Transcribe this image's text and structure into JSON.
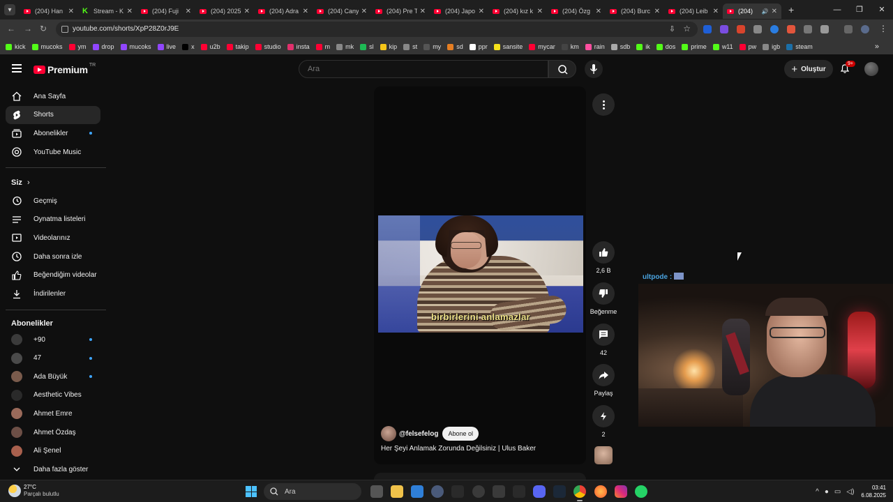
{
  "browser": {
    "tabs": [
      {
        "label": "(204) Han",
        "favicon": "youtube"
      },
      {
        "label": "Stream - K",
        "favicon": "kick"
      },
      {
        "label": "(204) Fuji",
        "favicon": "youtube"
      },
      {
        "label": "(204) 2025",
        "favicon": "youtube"
      },
      {
        "label": "(204) Adra",
        "favicon": "youtube"
      },
      {
        "label": "(204) Cany",
        "favicon": "youtube"
      },
      {
        "label": "(204) Pre T",
        "favicon": "youtube"
      },
      {
        "label": "(204) Japo",
        "favicon": "youtube"
      },
      {
        "label": "(204) kız k",
        "favicon": "youtube"
      },
      {
        "label": "(204) Özg",
        "favicon": "youtube"
      },
      {
        "label": "(204) Burc",
        "favicon": "youtube"
      },
      {
        "label": "(204) Leib",
        "favicon": "youtube"
      },
      {
        "label": "(204)",
        "favicon": "youtube",
        "active": true
      }
    ],
    "new_tab": "+",
    "url": "youtube.com/shorts/XpP28Z0rJ9E",
    "bookmarks": [
      {
        "label": "kick",
        "color": "#53fc18"
      },
      {
        "label": "mucoks",
        "color": "#53fc18"
      },
      {
        "label": "ym",
        "color": "#ff0033"
      },
      {
        "label": "drop",
        "color": "#9146ff"
      },
      {
        "label": "mucoks",
        "color": "#9146ff"
      },
      {
        "label": "live",
        "color": "#9146ff"
      },
      {
        "label": "x",
        "color": "#000000"
      },
      {
        "label": "u2b",
        "color": "#ff0033"
      },
      {
        "label": "takip",
        "color": "#ff0033"
      },
      {
        "label": "studio",
        "color": "#ff0033"
      },
      {
        "label": "insta",
        "color": "#e1306c"
      },
      {
        "label": "m",
        "color": "#ff0033"
      },
      {
        "label": "mk",
        "color": "#888888"
      },
      {
        "label": "sl",
        "color": "#1db954"
      },
      {
        "label": "kip",
        "color": "#f5c518"
      },
      {
        "label": "st",
        "color": "#888888"
      },
      {
        "label": "my",
        "color": "#555555"
      },
      {
        "label": "sd",
        "color": "#e67e22"
      },
      {
        "label": "ppr",
        "color": "#ffffff"
      },
      {
        "label": "sansite",
        "color": "#f5e11b"
      },
      {
        "label": "mycar",
        "color": "#ff0033"
      },
      {
        "label": "km",
        "color": "#444444"
      },
      {
        "label": "rain",
        "color": "#ff4fa0"
      },
      {
        "label": "sdb",
        "color": "#aaaaaa"
      },
      {
        "label": "ik",
        "color": "#53fc18"
      },
      {
        "label": "dos",
        "color": "#53fc18"
      },
      {
        "label": "prime",
        "color": "#53fc18"
      },
      {
        "label": "w11",
        "color": "#53fc18"
      },
      {
        "label": "pw",
        "color": "#ff0033"
      },
      {
        "label": "igb",
        "color": "#888888"
      },
      {
        "label": "steam",
        "color": "#1b6fa8"
      }
    ],
    "bookmarks_overflow": "»"
  },
  "youtube": {
    "logo_text": "Premium",
    "country_code": "TR",
    "search_placeholder": "Ara",
    "create_label": "Oluştur",
    "notif_badge": "9+"
  },
  "sidebar": {
    "main": [
      {
        "label": "Ana Sayfa",
        "icon": "home-icon"
      },
      {
        "label": "Shorts",
        "icon": "shorts-icon",
        "active": true
      },
      {
        "label": "Abonelikler",
        "icon": "subscriptions-icon",
        "dot": true
      },
      {
        "label": "YouTube Music",
        "icon": "music-icon"
      }
    ],
    "you_heading": "Siz",
    "you": [
      {
        "label": "Geçmiş",
        "icon": "history-icon"
      },
      {
        "label": "Oynatma listeleri",
        "icon": "playlist-icon"
      },
      {
        "label": "Videolarınız",
        "icon": "your-videos-icon"
      },
      {
        "label": "Daha sonra izle",
        "icon": "watch-later-icon"
      },
      {
        "label": "Beğendiğim videolar",
        "icon": "liked-icon"
      },
      {
        "label": "İndirilenler",
        "icon": "download-icon"
      }
    ],
    "subs_heading": "Abonelikler",
    "subs": [
      {
        "label": "+90",
        "color": "#3b3b3b",
        "dot": true
      },
      {
        "label": "47",
        "color": "#4a4a4a",
        "dot": true
      },
      {
        "label": "Ada Büyük",
        "color": "#7a5b4c",
        "dot": true
      },
      {
        "label": "Aesthetic Vibes",
        "color": "#2a2a2a"
      },
      {
        "label": "Ahmet Emre",
        "color": "#9a6a5a"
      },
      {
        "label": "Ahmet Özdaş",
        "color": "#6d4f46"
      },
      {
        "label": "Ali Şenel",
        "color": "#a8604d"
      }
    ],
    "show_more": "Daha fazla göster"
  },
  "short": {
    "subtitle": "birbirlerini anlamazlar",
    "channel": "@felsefelog",
    "subscribe_label": "Abone ol",
    "title": "Her Şeyi Anlamak Zorunda Değilsiniz | Ulus Baker",
    "likes": "2,6 B",
    "dislike_label": "Beğenme",
    "comments": "42",
    "share_label": "Paylaş",
    "remix_count": "2"
  },
  "overlay": {
    "chat_user": "ultpode :"
  },
  "taskbar": {
    "temperature": "27°C",
    "weather_desc": "Parçalı bulutlu",
    "search_label": "Ara",
    "time": "03:41",
    "date": "6.08.2025"
  },
  "colors": {
    "yt_red": "#ff0033",
    "accent_blue": "#3ea6ff",
    "background": "#0f0f0f"
  }
}
